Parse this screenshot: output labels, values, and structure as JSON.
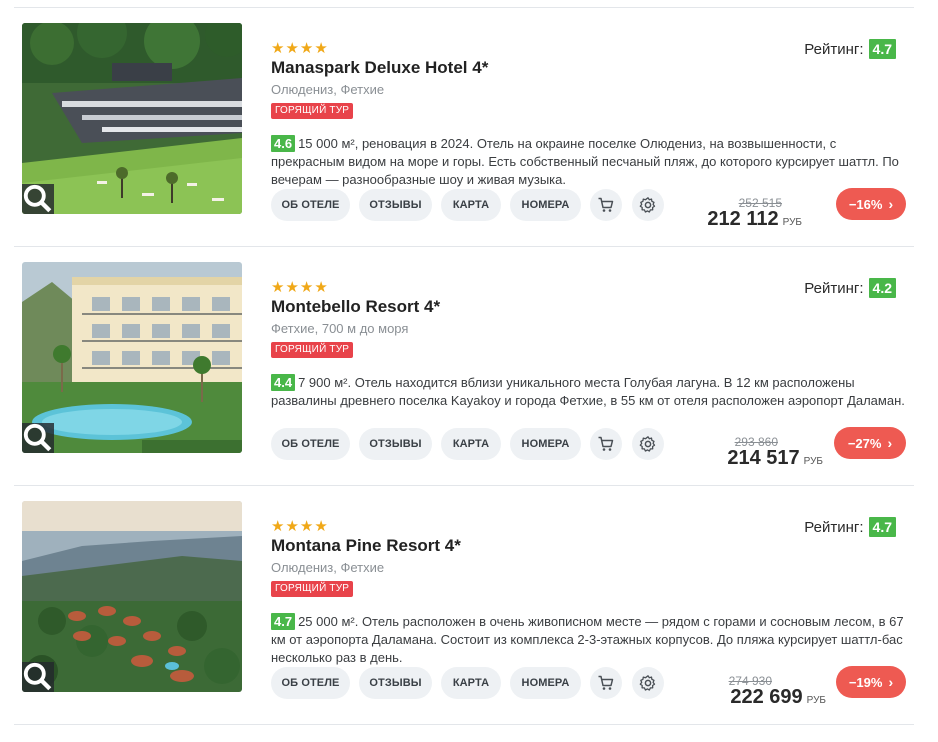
{
  "labels": {
    "rating_label": "Рейтинг:",
    "hot_tag": "ГОРЯЩИЙ ТУР",
    "currency": "РУБ",
    "about_hotel": "ОБ ОТЕЛЕ",
    "reviews": "ОТЗЫВЫ",
    "map": "КАРТА",
    "rooms": "НОМЕРА"
  },
  "hotels": [
    {
      "stars": 4,
      "name": "Manaspark Deluxe Hotel 4*",
      "location": "Олюдениз, Фетхие",
      "rating": "4.7",
      "score": "4.6",
      "description": "15 000 м², реновация в 2024. Отель на окраине поселке Олюдениз, на возвышенности, с прекрасным видом на море и горы. Есть собственный песчаный пляж, до которого курсирует шаттл. По вечерам — разнообразные шоу и живая музыка.",
      "old_price": "252 515",
      "price": "212 112",
      "discount": "−16%"
    },
    {
      "stars": 4,
      "name": "Montebello Resort 4*",
      "location": "Фетхие, 700 м до моря",
      "rating": "4.2",
      "score": "4.4",
      "description": "7 900 м². Отель находится вблизи уникального места Голубая лагуна. В 12 км расположены развалины древнего поселка Kayakoy и города Фетхие, в 55 км от отеля расположен аэропорт Даламан.",
      "old_price": "293 860",
      "price": "214 517",
      "discount": "−27%"
    },
    {
      "stars": 4,
      "name": "Montana Pine Resort 4*",
      "location": "Олюдениз, Фетхие",
      "rating": "4.7",
      "score": "4.7",
      "description": "25 000 м². Отель расположен в очень живописном месте — рядом с горами и сосновым лесом, в 67 км от аэропорта Даламана. Состоит из комплекса 2-3-этажных корпусов. До пляжа курсирует шаттл-бас несколько раз в день.",
      "old_price": "274 930",
      "price": "222 699",
      "discount": "−19%"
    }
  ],
  "colors": {
    "score_green": "#49b749",
    "hot_red": "#e8434a",
    "discount_red": "#ee5a52",
    "star_gold": "#f0a818",
    "button_bg": "#eef1f4"
  },
  "icons": {
    "zoom": "search-icon",
    "cart": "cart-icon",
    "settings": "gear-icon",
    "chevron": "chevron-right-icon"
  }
}
